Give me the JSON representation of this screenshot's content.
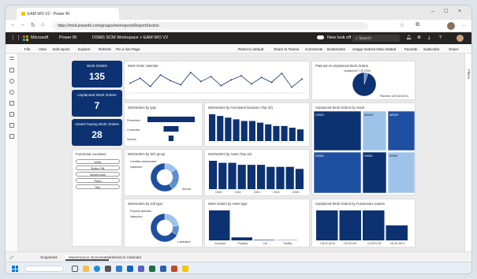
{
  "browser": {
    "tab_title": "EAM WO V2 - Power BI",
    "url": "https://msit.powerbi.com/groups/me/reports/ReportSection"
  },
  "app": {
    "brand": "Microsoft",
    "product": "Power BI",
    "breadcrumb": "DSMS SCM Workspace > EAM WO V2",
    "new_look": "New look off",
    "search_placeholder": "Search"
  },
  "toolbar": {
    "file": "File",
    "view": "View",
    "edit": "Edit report",
    "explore": "Explore",
    "refresh": "Refresh",
    "pin": "Pin a live Page",
    "reset": "Reset to default",
    "share_teams": "Share to Teams",
    "comments": "Comments",
    "bookmarks": "Bookmarks",
    "usage": "Usage metrics",
    "view_related": "View related",
    "favorite": "Favorite",
    "subscribe": "Subscribe",
    "share": "Share"
  },
  "filters_label": "Filters",
  "kpis": [
    {
      "title": "Work Orders",
      "value": "135"
    },
    {
      "title": "Unplanned Work Orders",
      "value": "7"
    },
    {
      "title": "Assets having Work Orders",
      "value": "28"
    }
  ],
  "slicer": {
    "title": "Functional Locations",
    "items": [
      "HWA",
      "Boiler Hill",
      "Warehouse",
      "Plant",
      "Site"
    ]
  },
  "visual_titles": {
    "calendar": "Work Order calendar",
    "planned_pie": "Planned vs Unplanned Work Orders",
    "by_type": "Workorders by type",
    "by_fl": "Workorders by Functional locations (Top 10)",
    "unplanned_asset": "Unplanned Work Orders by Asset",
    "by_wo_group": "Workorders by WO group",
    "by_asset": "Workorders by Asset (Top 10)",
    "by_job_type": "Workorders by Job type",
    "by_asset_type": "Work Orders by Asset type",
    "unplanned_fl": "Unplanned Work Orders by Functional Location"
  },
  "chart_data": [
    {
      "id": "calendar",
      "type": "line",
      "values": [
        12,
        18,
        8,
        22,
        15,
        10,
        25,
        14,
        20,
        9,
        16,
        21,
        11,
        19,
        13,
        24,
        7,
        17
      ]
    },
    {
      "id": "planned_pie",
      "type": "pie",
      "slices": [
        {
          "label": "Unplanned 7 (5.19%)",
          "value": 7
        },
        {
          "label": "Planned 128 (94.81%)",
          "value": 128
        }
      ]
    },
    {
      "id": "by_type",
      "type": "bar",
      "categories": [
        "Preventive",
        "Corrective",
        "Service"
      ],
      "values": [
        95,
        30,
        10
      ]
    },
    {
      "id": "by_fl",
      "type": "bar",
      "values": [
        16,
        15,
        14,
        13,
        12,
        12,
        11,
        10,
        9,
        9,
        8,
        7
      ]
    },
    {
      "id": "unplanned_asset",
      "type": "heatmap",
      "cells": [
        "CE001",
        "W0000",
        "W0002",
        "V0000",
        "V0002",
        "E0000"
      ]
    },
    {
      "id": "by_wo_group",
      "type": "pie",
      "slices": [
        {
          "label": "Condition assessment",
          "value": 20
        },
        {
          "label": "Inspection",
          "value": 35
        },
        {
          "label": "Service",
          "value": 80
        }
      ]
    },
    {
      "id": "by_asset",
      "type": "bar",
      "categories": [
        "C003",
        "C002",
        "C001",
        "C004",
        "C005"
      ],
      "values": [
        14,
        13,
        13,
        12,
        12,
        12,
        11,
        11,
        11,
        10
      ]
    },
    {
      "id": "by_job_type",
      "type": "pie",
      "slices": [
        {
          "label": "Property assessm",
          "value": 30
        },
        {
          "label": "Inspection",
          "value": 15
        },
        {
          "label": "Lubrication",
          "value": 90
        }
      ]
    },
    {
      "id": "by_asset_type",
      "type": "bar",
      "categories": [
        "Conveyor",
        "Property",
        "Car",
        "Facility"
      ],
      "values": [
        120,
        12,
        2,
        1
      ]
    },
    {
      "id": "unplanned_fl",
      "type": "bar",
      "categories": [
        "HA-01-AH-A",
        "CA-001-00...",
        "CA-EFG-02",
        "HA-01-AH-2"
      ],
      "values": [
        2,
        2,
        2,
        1
      ]
    }
  ],
  "pages": [
    "Snapshots",
    "Maintenance Overview",
    "Maintenance Calendar"
  ],
  "colors": {
    "navy": "#0d3271",
    "blue": "#1f4fa0",
    "light": "#9ec3e8",
    "mid": "#5d8fcf"
  }
}
